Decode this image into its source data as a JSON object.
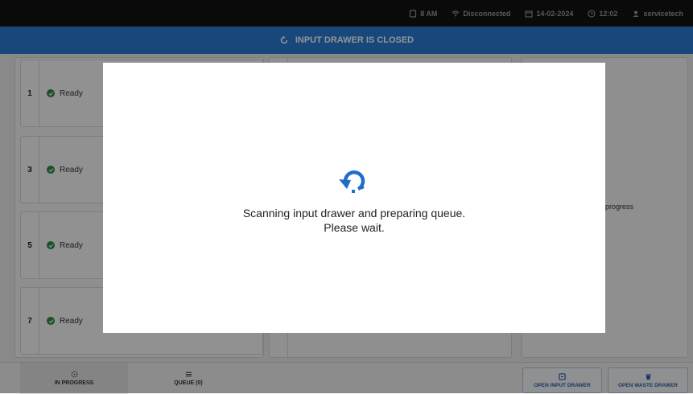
{
  "status_bar": {
    "time_label": "8 AM",
    "connection": "Disconnected",
    "date": "14-02-2024",
    "clock": "12:02",
    "user": "servicetech"
  },
  "banner": {
    "text": "INPUT DRAWER IS CLOSED",
    "color": "#2a7ad6"
  },
  "slots": [
    {
      "number": "1",
      "status": "Ready"
    },
    {
      "number": "3",
      "status": "Ready"
    },
    {
      "number": "5",
      "status": "Ready"
    },
    {
      "number": "7",
      "status": "Ready"
    }
  ],
  "right_panel": {
    "text": "progress"
  },
  "bottom_bar": {
    "tabs": [
      {
        "label": "IN PROGRESS",
        "icon": "progress-icon"
      },
      {
        "label": "QUEUE (0)",
        "icon": "list-icon"
      }
    ],
    "buttons": [
      {
        "label": "OPEN INPUT DRAWER",
        "icon": "drawer-icon"
      },
      {
        "label": "OPEN WASTE DRAWER",
        "icon": "trash-icon"
      }
    ]
  },
  "modal": {
    "line1": "Scanning input drawer and preparing queue.",
    "line2": "Please wait.",
    "icon": "refresh-icon",
    "icon_color": "#1f6fc8"
  }
}
